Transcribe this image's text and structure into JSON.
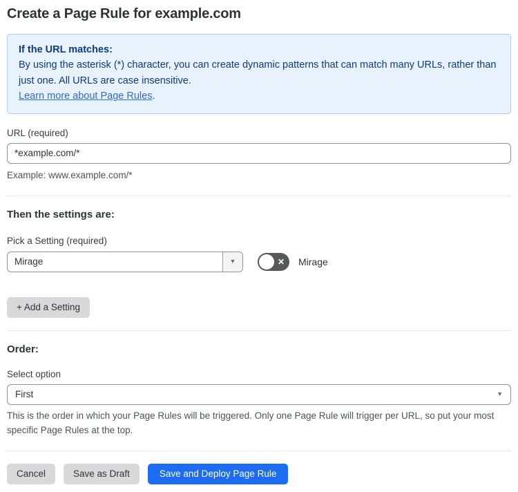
{
  "page": {
    "title": "Create a Page Rule for example.com"
  },
  "info_box": {
    "heading": "If the URL matches:",
    "body": "By using the asterisk (*) character, you can create dynamic patterns that can match many URLs, rather than just one. All URLs are case insensitive.",
    "link_label": "Learn more about Page Rules",
    "link_suffix": "."
  },
  "url_field": {
    "label": "URL (required)",
    "value": "*example.com/*",
    "helper": "Example: www.example.com/*"
  },
  "settings_section": {
    "heading": "Then the settings are:",
    "picker_label": "Pick a Setting (required)",
    "selected_setting": "Mirage",
    "toggle_label": "Mirage",
    "toggle_state": "off",
    "add_button_label": "+ Add a Setting"
  },
  "order_section": {
    "heading": "Order:",
    "select_label": "Select option",
    "selected_option": "First",
    "helper": "This is the order in which your Page Rules will be triggered. Only one Page Rule will trigger per URL, so put your most specific Page Rules at the top."
  },
  "footer": {
    "cancel_label": "Cancel",
    "save_draft_label": "Save as Draft",
    "save_deploy_label": "Save and Deploy Page Rule"
  },
  "icons": {
    "dropdown_caret": "▼",
    "toggle_off_glyph": "✕"
  },
  "colors": {
    "info_box_bg": "#e8f2fc",
    "info_box_border": "#abccf0",
    "info_text": "#0d3a80",
    "link": "#2b6cd9",
    "primary_button": "#1b6cf0",
    "gray_button": "#d9d9d9",
    "toggle_off_bg": "#565859"
  }
}
